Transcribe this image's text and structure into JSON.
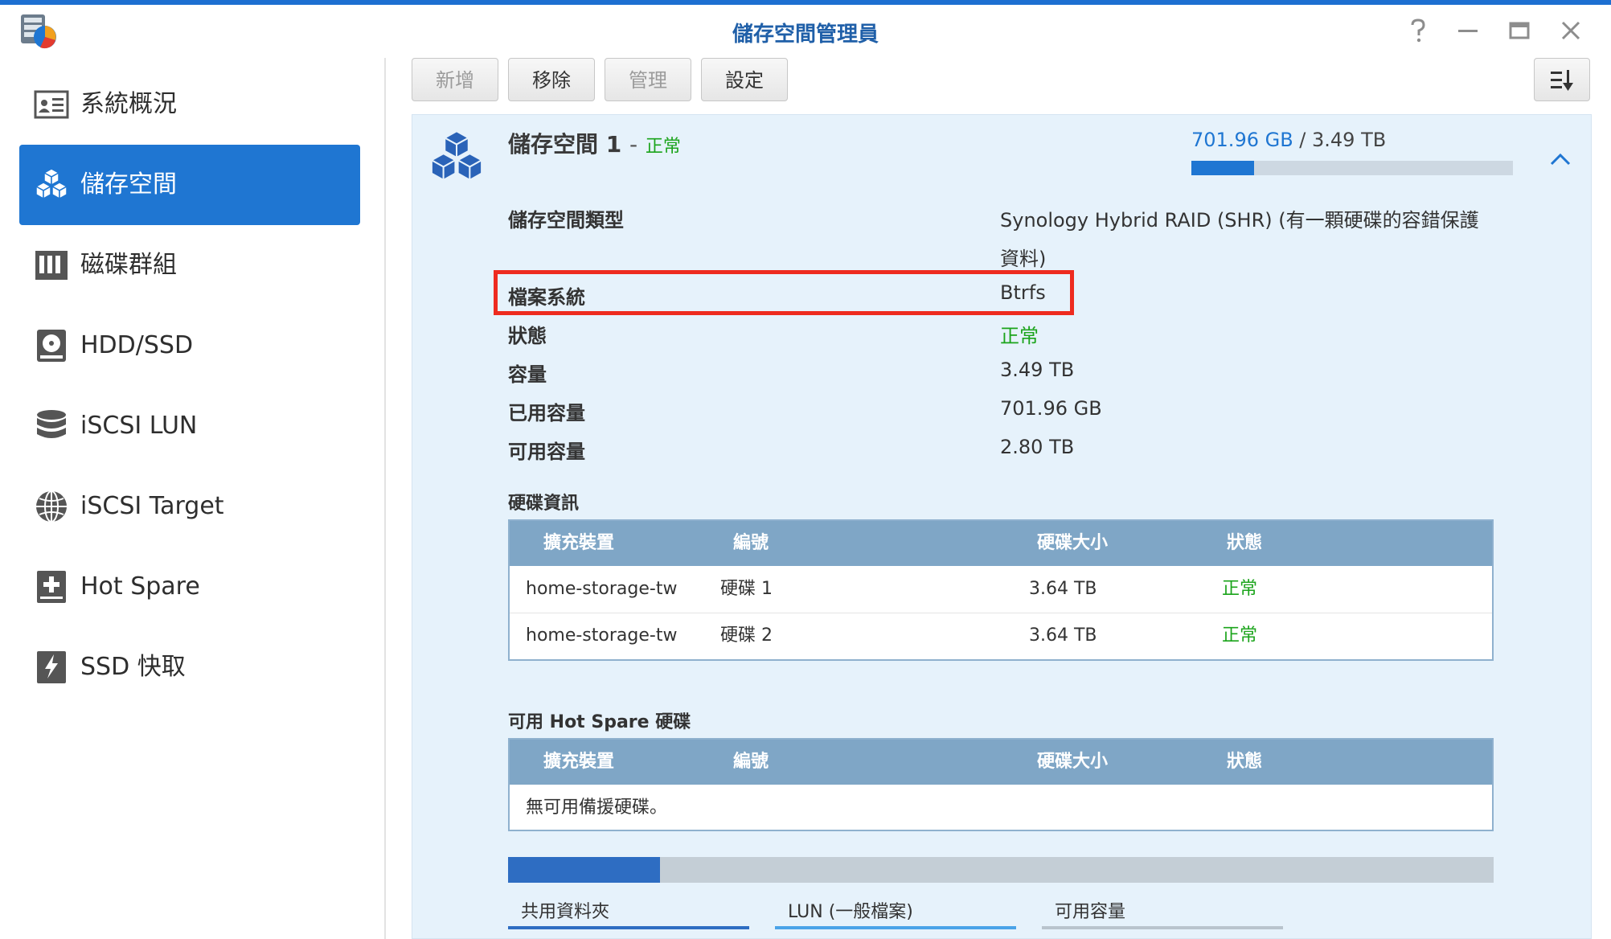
{
  "window": {
    "title": "儲存空間管理員"
  },
  "sidebar": {
    "items": [
      {
        "label": "系統概況",
        "icon": "system-overview-icon",
        "active": false
      },
      {
        "label": "儲存空間",
        "icon": "volume-cubes-icon",
        "active": true
      },
      {
        "label": "磁碟群組",
        "icon": "disk-group-icon",
        "active": false
      },
      {
        "label": "HDD/SSD",
        "icon": "hdd-icon",
        "active": false
      },
      {
        "label": "iSCSI LUN",
        "icon": "database-icon",
        "active": false
      },
      {
        "label": "iSCSI Target",
        "icon": "globe-icon",
        "active": false
      },
      {
        "label": "Hot Spare",
        "icon": "hot-spare-plus-icon",
        "active": false
      },
      {
        "label": "SSD 快取",
        "icon": "ssd-cache-lightning-icon",
        "active": false
      }
    ]
  },
  "toolbar": {
    "create_label": "新增",
    "remove_label": "移除",
    "manage_label": "管理",
    "settings_label": "設定"
  },
  "volume": {
    "name": "儲存空間 1",
    "separator": "-",
    "status": "正常",
    "used": "701.96 GB",
    "usage_sep": " / ",
    "total": "3.49 TB",
    "usage_fraction": 0.196,
    "properties": [
      {
        "label": "儲存空間類型",
        "value_line1": "Synology Hybrid RAID (SHR) (有一顆硬碟的容錯保護",
        "value_line2": "資料)"
      },
      {
        "label": "檔案系統",
        "value": "Btrfs"
      },
      {
        "label": "狀態",
        "value": "正常"
      },
      {
        "label": "容量",
        "value": "3.49 TB"
      },
      {
        "label": "已用容量",
        "value": "701.96 GB"
      },
      {
        "label": "可用容量",
        "value": "2.80 TB"
      }
    ]
  },
  "disk_info": {
    "title": "硬碟資訊",
    "columns": [
      "擴充裝置",
      "編號",
      "硬碟大小",
      "狀態"
    ],
    "rows": [
      [
        "home-storage-tw",
        "硬碟 1",
        "3.64 TB",
        "正常"
      ],
      [
        "home-storage-tw",
        "硬碟 2",
        "3.64 TB",
        "正常"
      ]
    ]
  },
  "hot_spare": {
    "title": "可用 Hot Spare 硬碟",
    "columns": [
      "擴充裝置",
      "編號",
      "硬碟大小",
      "狀態"
    ],
    "empty_text": "無可用備援硬碟。"
  },
  "usage_breakdown": {
    "shared_fraction": 0.154,
    "legend": [
      "共用資料夾",
      "LUN (一般檔案)",
      "可用容量"
    ]
  },
  "colors": {
    "accent": "#1f76d2",
    "ok": "#1ba41b",
    "highlight": "#ee2b1f",
    "table_header": "#7fa6c6"
  }
}
